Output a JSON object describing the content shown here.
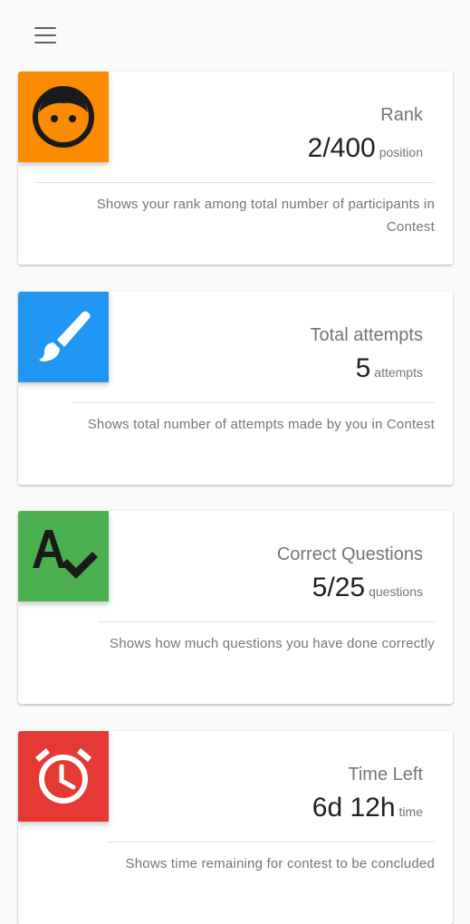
{
  "header": {
    "menu_icon": "hamburger-menu-icon"
  },
  "cards": [
    {
      "icon": "child-face-icon",
      "icon_color": "#FB8C00",
      "title": "Rank",
      "value": "2/400",
      "unit": "position",
      "description": "Shows your rank among total number of participants in Contest"
    },
    {
      "icon": "brush-icon",
      "icon_color": "#2196F3",
      "title": "Total attempts",
      "value": "5",
      "unit": "attempts",
      "description": "Shows total number of attempts made by you in Contest"
    },
    {
      "icon": "spellcheck-icon",
      "icon_color": "#4CAF50",
      "title": "Correct Questions",
      "value": "5/25",
      "unit": "questions",
      "description": "Shows how much questions you have done correctly"
    },
    {
      "icon": "alarm-icon",
      "icon_color": "#E53935",
      "title": "Time Left",
      "value": "6d 12h",
      "unit": "time",
      "description": "Shows time remaining for contest to be concluded"
    }
  ]
}
